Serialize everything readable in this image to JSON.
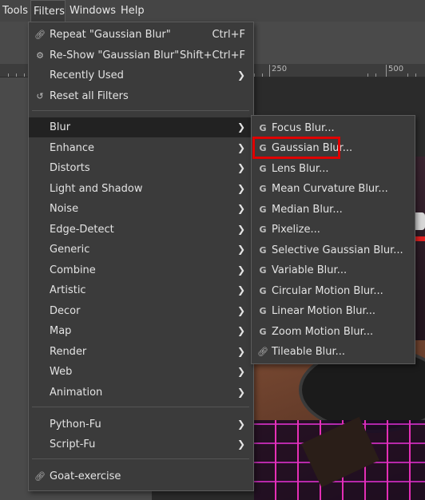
{
  "menubar": {
    "items": [
      {
        "label": "Tools"
      },
      {
        "label": "Filters"
      },
      {
        "label": "Windows"
      },
      {
        "label": "Help"
      }
    ]
  },
  "ruler": {
    "labels": [
      "250",
      "500"
    ]
  },
  "filters_menu": {
    "top_items": [
      {
        "label": "Repeat \"Gaussian Blur\"",
        "shortcut": "Ctrl+F",
        "icon": "repeat-icon"
      },
      {
        "label": "Re-Show \"Gaussian Blur\"",
        "shortcut": "Shift+Ctrl+F",
        "icon": "reshow-icon"
      },
      {
        "label": "Recently Used",
        "icon": ""
      },
      {
        "label": "Reset all Filters",
        "icon": "reset-icon"
      }
    ],
    "categories": [
      {
        "label": "Blur"
      },
      {
        "label": "Enhance"
      },
      {
        "label": "Distorts"
      },
      {
        "label": "Light and Shadow"
      },
      {
        "label": "Noise"
      },
      {
        "label": "Edge-Detect"
      },
      {
        "label": "Generic"
      },
      {
        "label": "Combine"
      },
      {
        "label": "Artistic"
      },
      {
        "label": "Decor"
      },
      {
        "label": "Map"
      },
      {
        "label": "Render"
      },
      {
        "label": "Web"
      },
      {
        "label": "Animation"
      }
    ],
    "script_items": [
      {
        "label": "Python-Fu"
      },
      {
        "label": "Script-Fu"
      }
    ],
    "extra_items": [
      {
        "label": "Goat-exercise",
        "icon": "plugin-icon"
      }
    ]
  },
  "blur_menu": {
    "items": [
      {
        "label": "Focus Blur...",
        "icon": "gegl-icon"
      },
      {
        "label": "Gaussian Blur...",
        "icon": "gegl-icon"
      },
      {
        "label": "Lens Blur...",
        "icon": "gegl-icon"
      },
      {
        "label": "Mean Curvature Blur...",
        "icon": "gegl-icon"
      },
      {
        "label": "Median Blur...",
        "icon": "gegl-icon"
      },
      {
        "label": "Pixelize...",
        "icon": "gegl-icon"
      },
      {
        "label": "Selective Gaussian Blur...",
        "icon": "gegl-icon"
      },
      {
        "label": "Variable Blur...",
        "icon": "gegl-icon"
      },
      {
        "label": "Circular Motion Blur...",
        "icon": "gegl-icon"
      },
      {
        "label": "Linear Motion Blur...",
        "icon": "gegl-icon"
      },
      {
        "label": "Zoom Motion Blur...",
        "icon": "gegl-icon"
      },
      {
        "label": "Tileable Blur...",
        "icon": "plugin-icon"
      }
    ],
    "gegl_glyph": "G"
  },
  "colors": {
    "highlight_box": "#e00000",
    "menu_bg": "#3b3b3b"
  }
}
